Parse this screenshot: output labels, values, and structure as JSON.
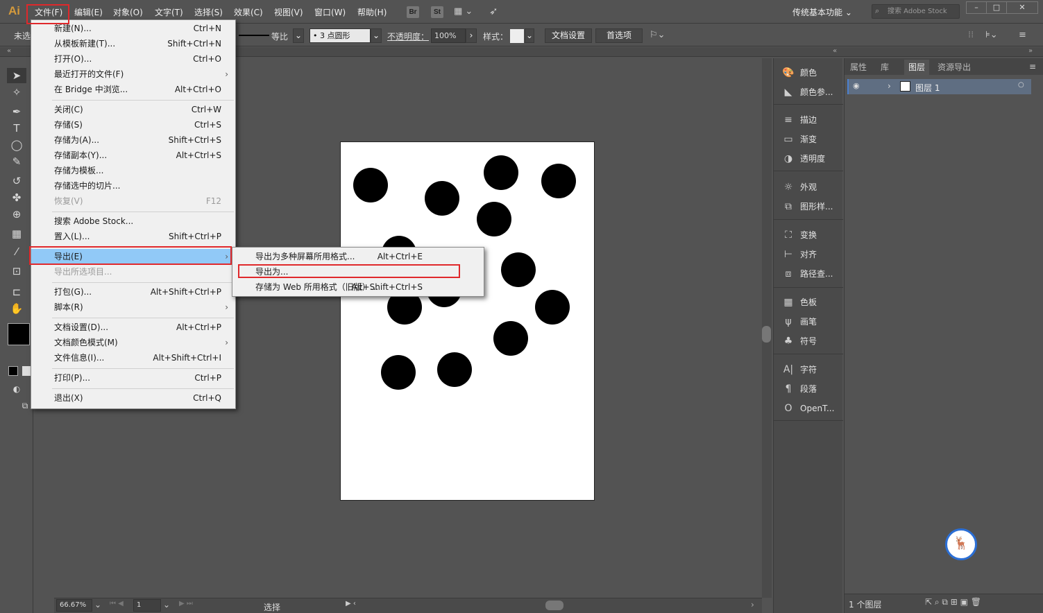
{
  "app": {
    "logo": "Ai"
  },
  "menubar": {
    "items": [
      "文件(F)",
      "编辑(E)",
      "对象(O)",
      "文字(T)",
      "选择(S)",
      "效果(C)",
      "视图(V)",
      "窗口(W)",
      "帮助(H)"
    ],
    "bridge": "Br",
    "stock": "St",
    "workspace": "传统基本功能",
    "search_placeholder": "搜索 Adobe Stock"
  },
  "control": {
    "selection": "未选",
    "stroke_profile": "等比",
    "brush": "3 点圆形",
    "opacity_label": "不透明度：",
    "opacity_value": "100%",
    "style_label": "样式：",
    "doc_setup": "文档设置",
    "preferences": "首选项"
  },
  "file_menu": [
    {
      "label": "新建(N)...",
      "shortcut": "Ctrl+N"
    },
    {
      "label": "从模板新建(T)...",
      "shortcut": "Shift+Ctrl+N"
    },
    {
      "label": "打开(O)...",
      "shortcut": "Ctrl+O"
    },
    {
      "label": "最近打开的文件(F)",
      "shortcut": ""
    },
    {
      "label": "在 Bridge 中浏览...",
      "shortcut": "Alt+Ctrl+O"
    },
    {
      "label": "关闭(C)",
      "shortcut": "Ctrl+W"
    },
    {
      "label": "存储(S)",
      "shortcut": "Ctrl+S"
    },
    {
      "label": "存储为(A)...",
      "shortcut": "Shift+Ctrl+S"
    },
    {
      "label": "存储副本(Y)...",
      "shortcut": "Alt+Ctrl+S"
    },
    {
      "label": "存储为模板...",
      "shortcut": ""
    },
    {
      "label": "存储选中的切片...",
      "shortcut": ""
    },
    {
      "label": "恢复(V)",
      "shortcut": "F12"
    },
    {
      "label": "搜索 Adobe Stock...",
      "shortcut": ""
    },
    {
      "label": "置入(L)...",
      "shortcut": "Shift+Ctrl+P"
    },
    {
      "label": "导出(E)",
      "shortcut": ""
    },
    {
      "label": "导出所选项目...",
      "shortcut": ""
    },
    {
      "label": "打包(G)...",
      "shortcut": "Alt+Shift+Ctrl+P"
    },
    {
      "label": "脚本(R)",
      "shortcut": ""
    },
    {
      "label": "文档设置(D)...",
      "shortcut": "Alt+Ctrl+P"
    },
    {
      "label": "文档颜色模式(M)",
      "shortcut": ""
    },
    {
      "label": "文件信息(I)...",
      "shortcut": "Alt+Shift+Ctrl+I"
    },
    {
      "label": "打印(P)...",
      "shortcut": "Ctrl+P"
    },
    {
      "label": "退出(X)",
      "shortcut": "Ctrl+Q"
    }
  ],
  "export_submenu": [
    {
      "label": "导出为多种屏幕所用格式...",
      "shortcut": "Alt+Ctrl+E"
    },
    {
      "label": "导出为...",
      "shortcut": ""
    },
    {
      "label": "存储为 Web 所用格式（旧版）...",
      "shortcut": "Alt+Shift+Ctrl+S"
    }
  ],
  "dock": [
    "颜色",
    "颜色参...",
    "描边",
    "渐变",
    "透明度",
    "外观",
    "图形样...",
    "变换",
    "对齐",
    "路径查...",
    "色板",
    "画笔",
    "符号",
    "字符",
    "段落",
    "OpenT..."
  ],
  "layers_panel": {
    "tabs": [
      "属性",
      "库",
      "图层",
      "资源导出"
    ],
    "layer_name": "图层 1",
    "count": "1 个图层"
  },
  "status": {
    "zoom": "66.67%",
    "page": "1",
    "tool": "选择"
  }
}
